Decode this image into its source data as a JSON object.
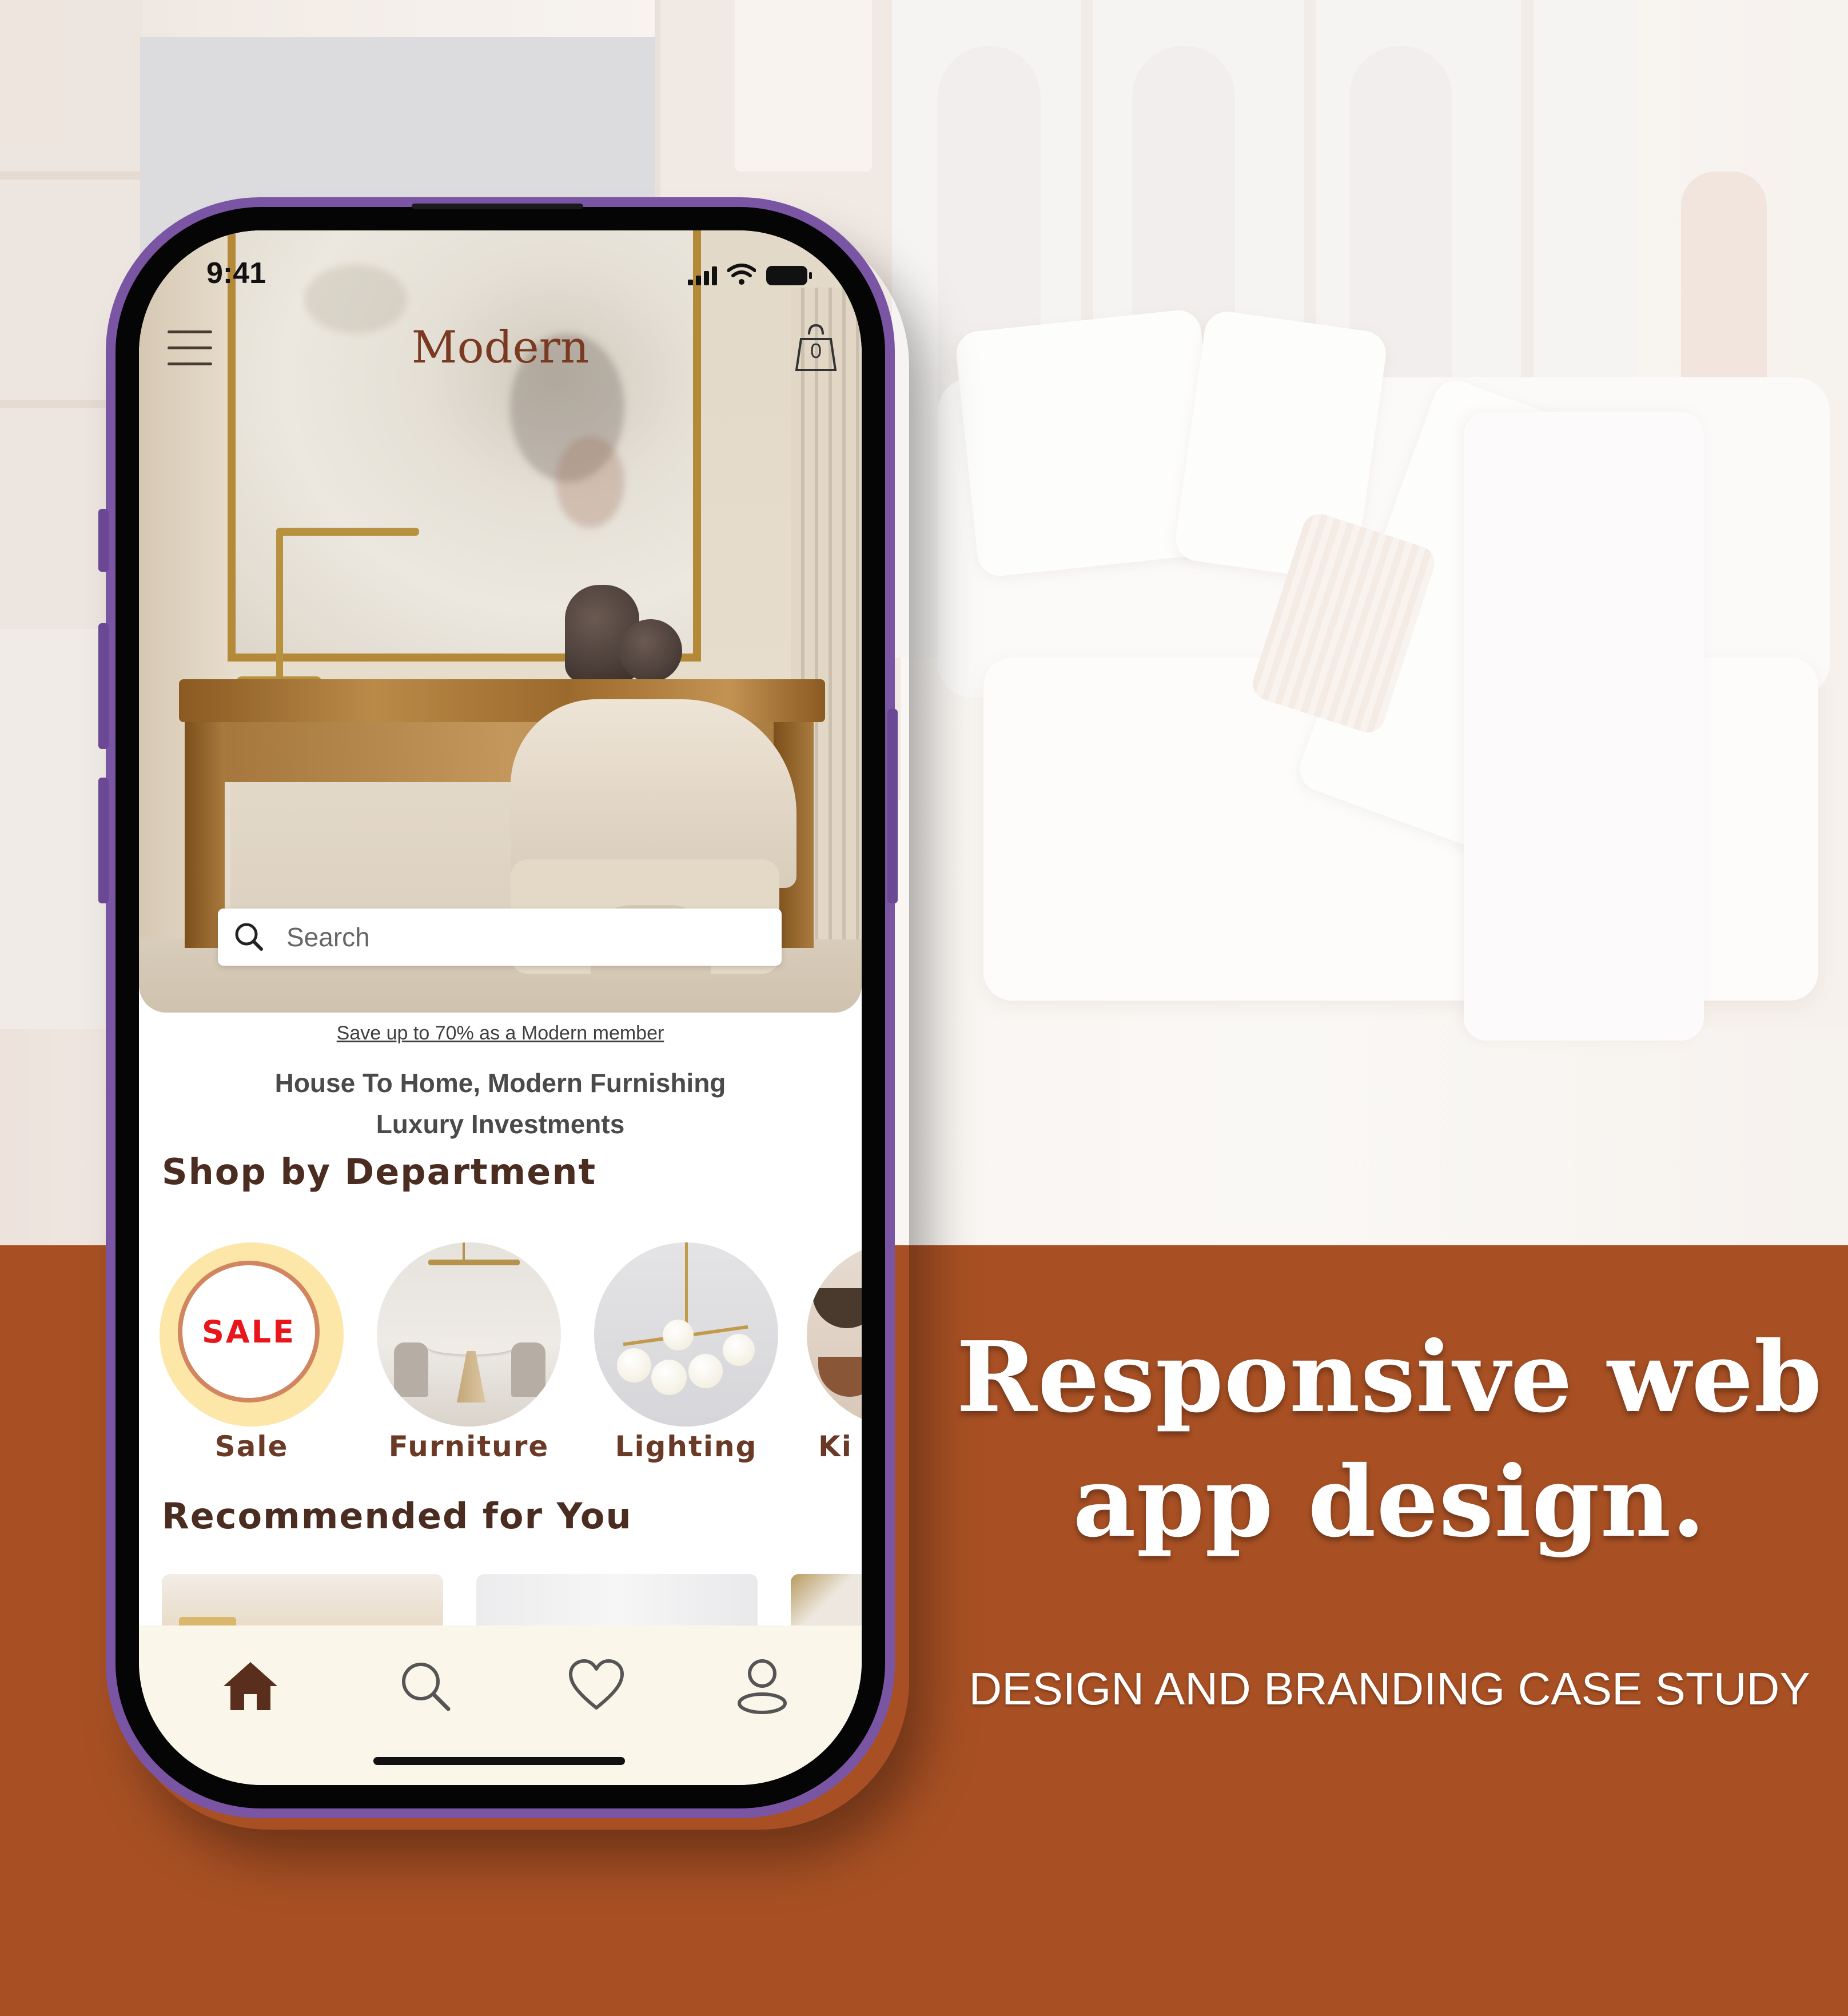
{
  "phone": {
    "status_time": "9:41",
    "brand": "Modern",
    "cart_count": "0",
    "search": {
      "placeholder": "Search"
    },
    "promo": "Save up to 70% as a Modern member",
    "tagline_line1": "House To Home, Modern Furnishing",
    "tagline_line2": "Luxury Investments",
    "shop_title": "Shop by Department",
    "departments": [
      {
        "label": "Sale",
        "badge": "SALE"
      },
      {
        "label": "Furniture"
      },
      {
        "label": "Lighting"
      },
      {
        "label": "Ki"
      }
    ],
    "recommended_title": "Recommended for You",
    "tabs": [
      "home-icon",
      "search-icon",
      "heart-icon",
      "user-icon"
    ]
  },
  "banner": {
    "headline_line1": "Responsive web",
    "headline_line2": "app design.",
    "subline": "DESIGN AND BRANDING CASE STUDY"
  },
  "colors": {
    "banner_bg": "#a85024",
    "phone_frame": "#7a55a4",
    "brand_text": "#7a3a22",
    "sale_red": "#e8151b",
    "tabbar_bg": "#fbf6ea"
  }
}
